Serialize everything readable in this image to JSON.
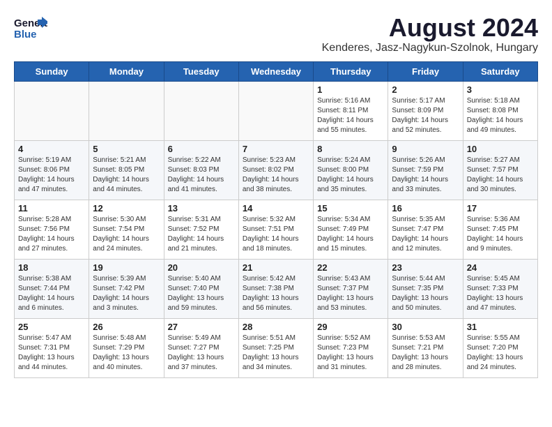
{
  "header": {
    "logo_general": "General",
    "logo_blue": "Blue",
    "month_year": "August 2024",
    "location": "Kenderes, Jasz-Nagykun-Szolnok, Hungary"
  },
  "weekdays": [
    "Sunday",
    "Monday",
    "Tuesday",
    "Wednesday",
    "Thursday",
    "Friday",
    "Saturday"
  ],
  "weeks": [
    [
      {
        "day": "",
        "detail": ""
      },
      {
        "day": "",
        "detail": ""
      },
      {
        "day": "",
        "detail": ""
      },
      {
        "day": "",
        "detail": ""
      },
      {
        "day": "1",
        "detail": "Sunrise: 5:16 AM\nSunset: 8:11 PM\nDaylight: 14 hours\nand 55 minutes."
      },
      {
        "day": "2",
        "detail": "Sunrise: 5:17 AM\nSunset: 8:09 PM\nDaylight: 14 hours\nand 52 minutes."
      },
      {
        "day": "3",
        "detail": "Sunrise: 5:18 AM\nSunset: 8:08 PM\nDaylight: 14 hours\nand 49 minutes."
      }
    ],
    [
      {
        "day": "4",
        "detail": "Sunrise: 5:19 AM\nSunset: 8:06 PM\nDaylight: 14 hours\nand 47 minutes."
      },
      {
        "day": "5",
        "detail": "Sunrise: 5:21 AM\nSunset: 8:05 PM\nDaylight: 14 hours\nand 44 minutes."
      },
      {
        "day": "6",
        "detail": "Sunrise: 5:22 AM\nSunset: 8:03 PM\nDaylight: 14 hours\nand 41 minutes."
      },
      {
        "day": "7",
        "detail": "Sunrise: 5:23 AM\nSunset: 8:02 PM\nDaylight: 14 hours\nand 38 minutes."
      },
      {
        "day": "8",
        "detail": "Sunrise: 5:24 AM\nSunset: 8:00 PM\nDaylight: 14 hours\nand 35 minutes."
      },
      {
        "day": "9",
        "detail": "Sunrise: 5:26 AM\nSunset: 7:59 PM\nDaylight: 14 hours\nand 33 minutes."
      },
      {
        "day": "10",
        "detail": "Sunrise: 5:27 AM\nSunset: 7:57 PM\nDaylight: 14 hours\nand 30 minutes."
      }
    ],
    [
      {
        "day": "11",
        "detail": "Sunrise: 5:28 AM\nSunset: 7:56 PM\nDaylight: 14 hours\nand 27 minutes."
      },
      {
        "day": "12",
        "detail": "Sunrise: 5:30 AM\nSunset: 7:54 PM\nDaylight: 14 hours\nand 24 minutes."
      },
      {
        "day": "13",
        "detail": "Sunrise: 5:31 AM\nSunset: 7:52 PM\nDaylight: 14 hours\nand 21 minutes."
      },
      {
        "day": "14",
        "detail": "Sunrise: 5:32 AM\nSunset: 7:51 PM\nDaylight: 14 hours\nand 18 minutes."
      },
      {
        "day": "15",
        "detail": "Sunrise: 5:34 AM\nSunset: 7:49 PM\nDaylight: 14 hours\nand 15 minutes."
      },
      {
        "day": "16",
        "detail": "Sunrise: 5:35 AM\nSunset: 7:47 PM\nDaylight: 14 hours\nand 12 minutes."
      },
      {
        "day": "17",
        "detail": "Sunrise: 5:36 AM\nSunset: 7:45 PM\nDaylight: 14 hours\nand 9 minutes."
      }
    ],
    [
      {
        "day": "18",
        "detail": "Sunrise: 5:38 AM\nSunset: 7:44 PM\nDaylight: 14 hours\nand 6 minutes."
      },
      {
        "day": "19",
        "detail": "Sunrise: 5:39 AM\nSunset: 7:42 PM\nDaylight: 14 hours\nand 3 minutes."
      },
      {
        "day": "20",
        "detail": "Sunrise: 5:40 AM\nSunset: 7:40 PM\nDaylight: 13 hours\nand 59 minutes."
      },
      {
        "day": "21",
        "detail": "Sunrise: 5:42 AM\nSunset: 7:38 PM\nDaylight: 13 hours\nand 56 minutes."
      },
      {
        "day": "22",
        "detail": "Sunrise: 5:43 AM\nSunset: 7:37 PM\nDaylight: 13 hours\nand 53 minutes."
      },
      {
        "day": "23",
        "detail": "Sunrise: 5:44 AM\nSunset: 7:35 PM\nDaylight: 13 hours\nand 50 minutes."
      },
      {
        "day": "24",
        "detail": "Sunrise: 5:45 AM\nSunset: 7:33 PM\nDaylight: 13 hours\nand 47 minutes."
      }
    ],
    [
      {
        "day": "25",
        "detail": "Sunrise: 5:47 AM\nSunset: 7:31 PM\nDaylight: 13 hours\nand 44 minutes."
      },
      {
        "day": "26",
        "detail": "Sunrise: 5:48 AM\nSunset: 7:29 PM\nDaylight: 13 hours\nand 40 minutes."
      },
      {
        "day": "27",
        "detail": "Sunrise: 5:49 AM\nSunset: 7:27 PM\nDaylight: 13 hours\nand 37 minutes."
      },
      {
        "day": "28",
        "detail": "Sunrise: 5:51 AM\nSunset: 7:25 PM\nDaylight: 13 hours\nand 34 minutes."
      },
      {
        "day": "29",
        "detail": "Sunrise: 5:52 AM\nSunset: 7:23 PM\nDaylight: 13 hours\nand 31 minutes."
      },
      {
        "day": "30",
        "detail": "Sunrise: 5:53 AM\nSunset: 7:21 PM\nDaylight: 13 hours\nand 28 minutes."
      },
      {
        "day": "31",
        "detail": "Sunrise: 5:55 AM\nSunset: 7:20 PM\nDaylight: 13 hours\nand 24 minutes."
      }
    ]
  ]
}
